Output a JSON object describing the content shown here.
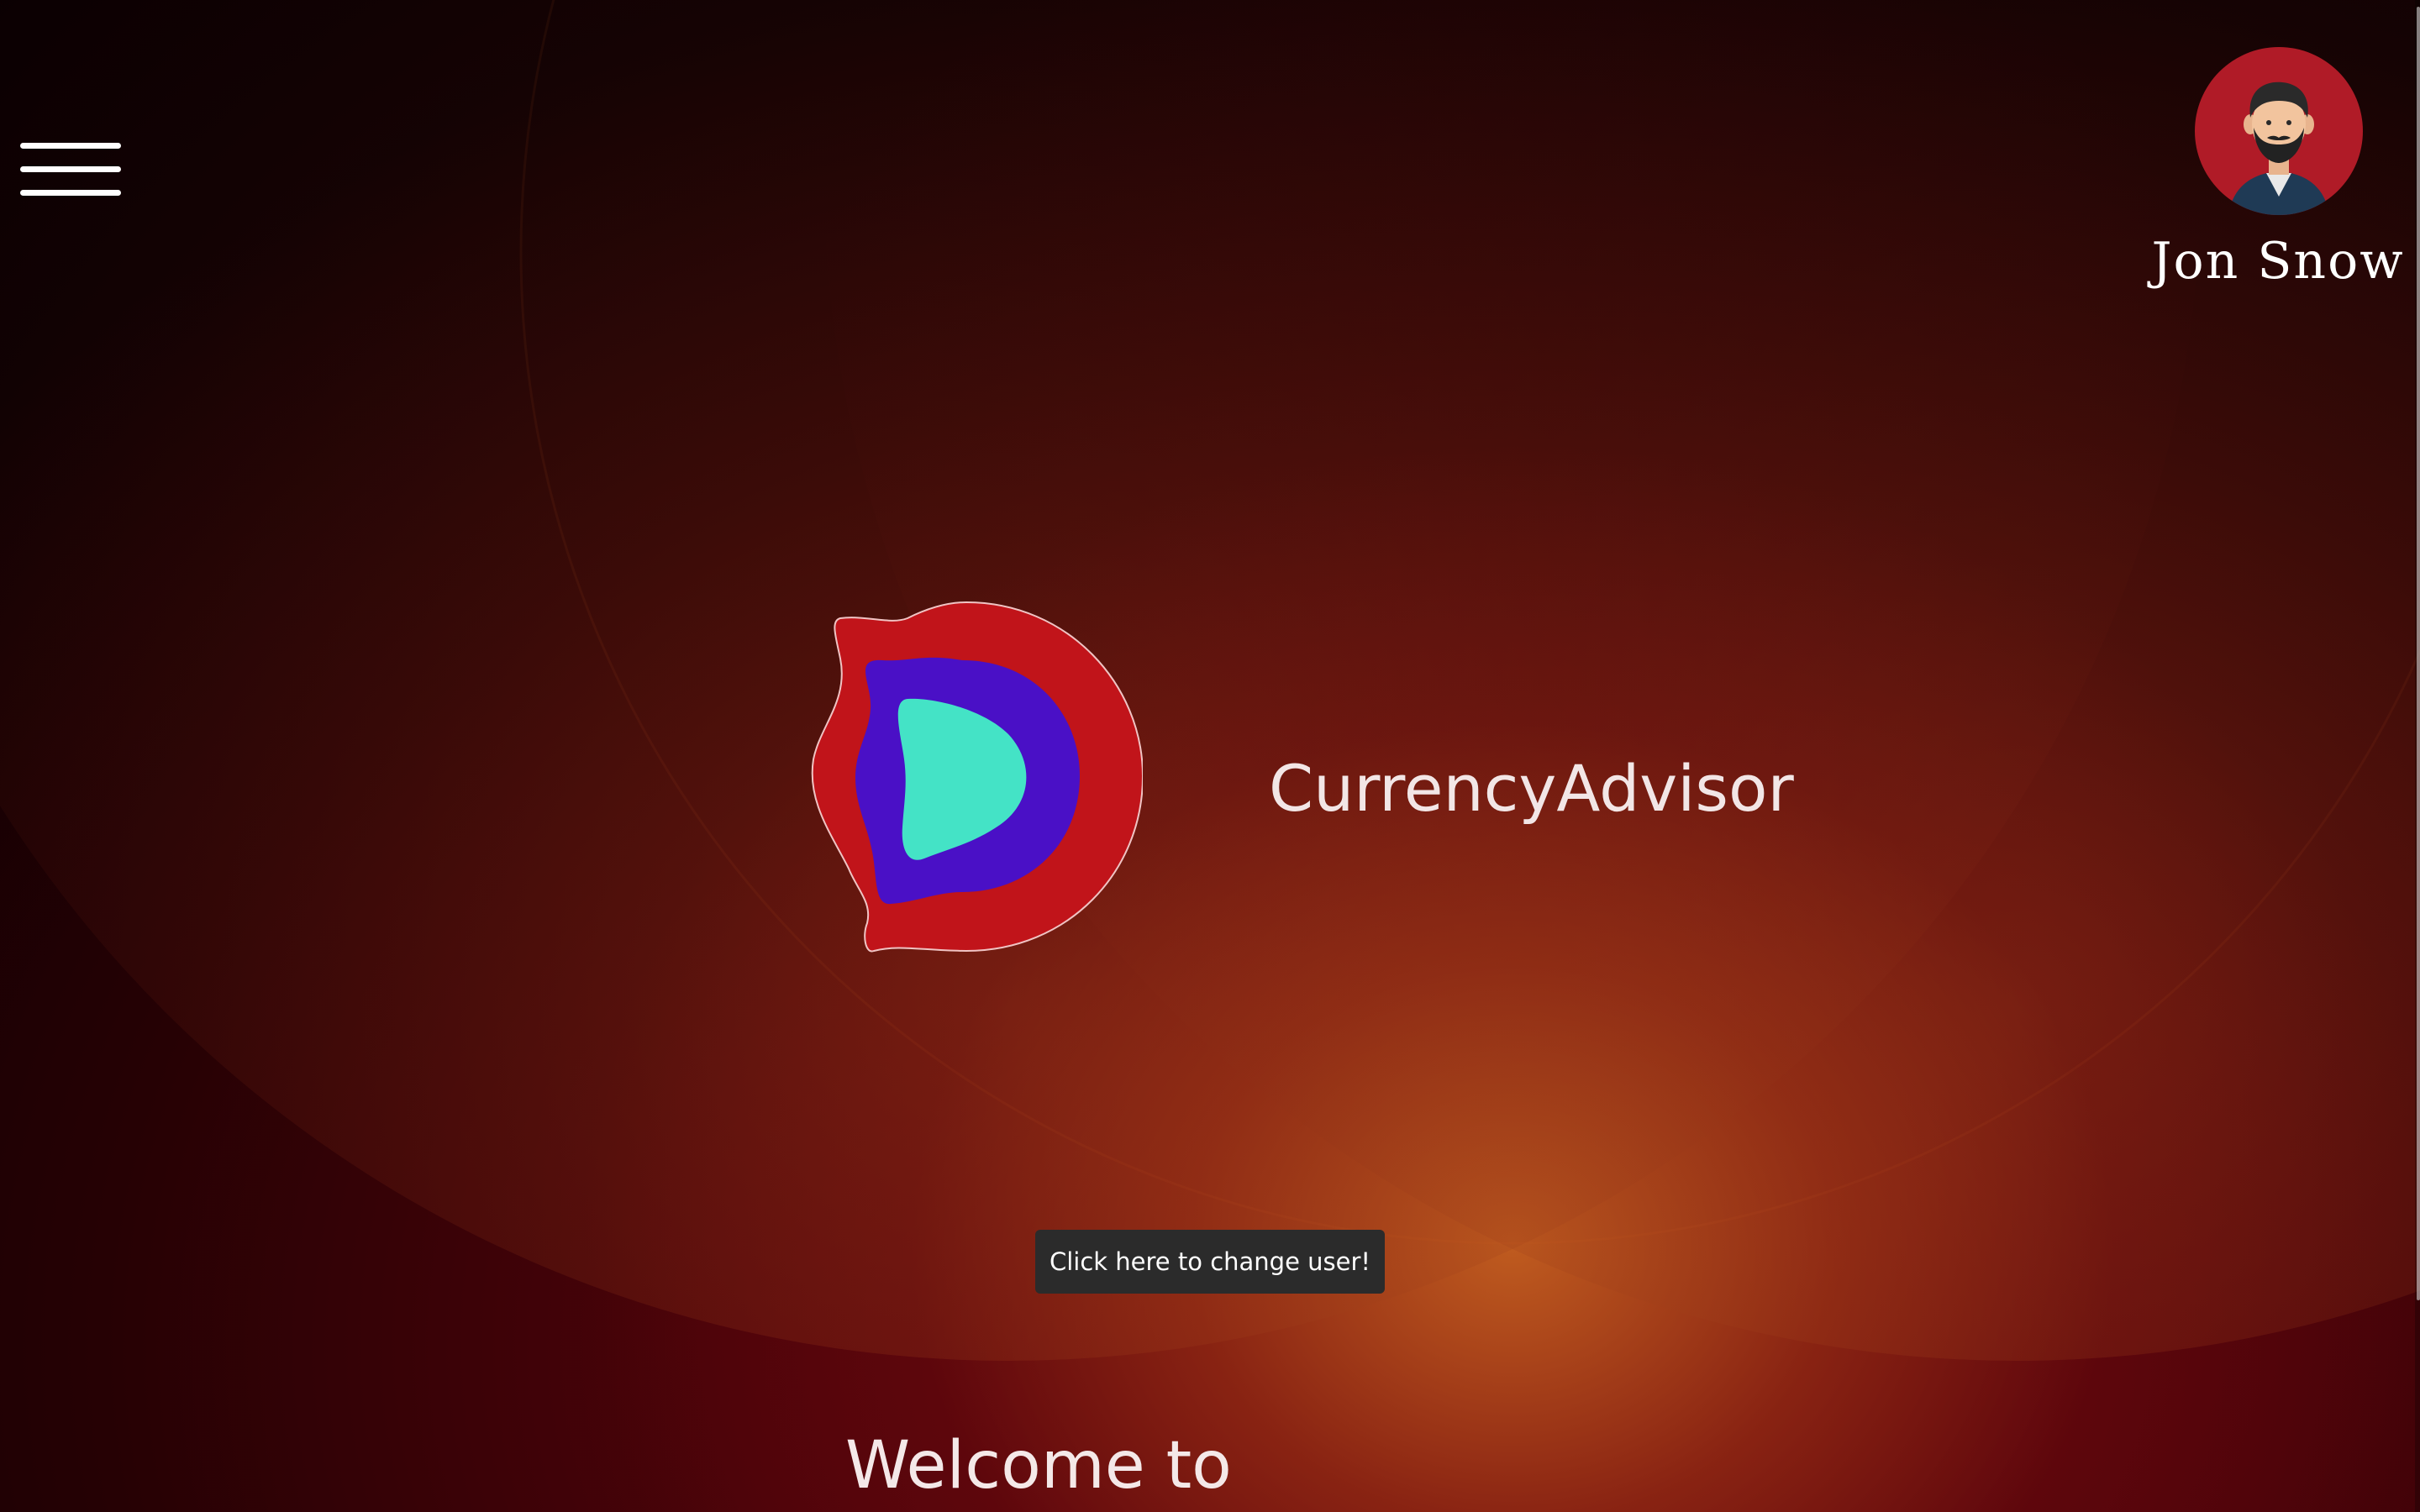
{
  "header": {
    "menu_icon": "hamburger-menu-icon"
  },
  "user": {
    "name": "Jon Snow",
    "avatar_icon": "bearded-man-avatar-icon"
  },
  "brand": {
    "app_name": "CurrencyAdvisor",
    "logo_icon": "currencyadvisor-d-logo",
    "logo_colors": {
      "outer": "#c1141a",
      "middle": "#4a10c6",
      "inner": "#44e3c6"
    }
  },
  "tooltip": {
    "text": "Click here to change user!"
  },
  "main": {
    "welcome_text": "Welcome to"
  },
  "theme": {
    "background_dark": "#1a0104",
    "background_red": "#6e0710",
    "glow_orange": "#c46020",
    "avatar_bg": "#b01b27"
  }
}
